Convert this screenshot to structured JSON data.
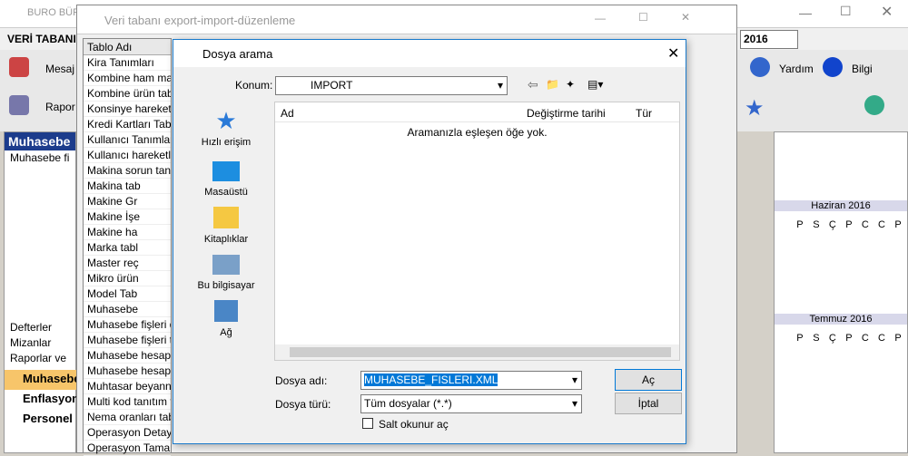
{
  "main": {
    "title": "BURO BÜR",
    "menu": "VERİ TABANI",
    "year": "2016",
    "mesaj": "Mesaj",
    "rapor": "Rapor",
    "yardim": "Yardım",
    "bilgi": "Bilgi",
    "panel": "Muhasebe",
    "tree_root": "Muhasebe fi",
    "defterler": "Defterler",
    "mizanlar": "Mizanlar",
    "raporlar": "Raporlar ve",
    "nav": [
      "Muhasebe",
      "Enflasyon",
      "Personel"
    ]
  },
  "editor": {
    "title": "Veri tabanı export-import-düzenleme",
    "col": "Tablo Adı",
    "items": [
      "Kira Tanımları",
      "Kombine ham madd",
      "Kombine ürün tablo",
      "Konsinye hareketler",
      "Kredi Kartları Tablos",
      "Kullanıcı Tanımları Ta",
      "Kullanıcı hareketleri",
      "Makina sorun tanım",
      "Makina tab",
      "Makine Gr",
      "Makine İşe",
      "Makine ha",
      "Marka tabl",
      "Master reç",
      "Mikro ürün",
      "Model Tab",
      "Muhasebe",
      "Muhasebe fişleri de",
      "Muhasebe fişleri tab",
      "Muhasebe hesap pla",
      "Muhasebe hesap pla",
      "Muhtasar beyannam",
      "Multi kod tanıtım tab",
      "Nema oranları tablo",
      "Operasyon Detayla",
      "Operasyon Tamaml"
    ]
  },
  "dialog": {
    "title": "Dosya arama",
    "konum_label": "Konum:",
    "konum": "IMPORT",
    "places": [
      "Hızlı erişim",
      "Masaüstü",
      "Kitaplıklar",
      "Bu bilgisayar",
      "Ağ"
    ],
    "cols": [
      "Ad",
      "Değiştirme tarihi",
      "Tür"
    ],
    "empty": "Aramanızla eşleşen öğe yok.",
    "fname_label": "Dosya adı:",
    "fname": "MUHASEBE_FISLERI.XML",
    "ftype_label": "Dosya türü:",
    "ftype": "Tüm dosyalar (*.*)",
    "readonly": "Salt okunur aç",
    "open": "Aç",
    "cancel": "İptal"
  },
  "cal": {
    "m1": "Haziran 2016",
    "m2": "Temmuz 2016",
    "days": [
      "P",
      "S",
      "Ç",
      "P",
      "C",
      "C",
      "P"
    ]
  }
}
